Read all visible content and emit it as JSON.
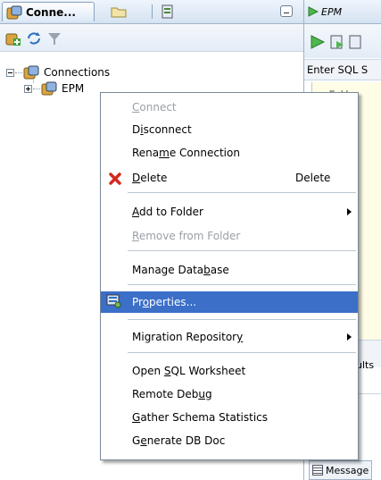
{
  "left": {
    "tabs": [
      {
        "label": "Conne..."
      }
    ],
    "tree": {
      "root": "Connections",
      "child": "EPM"
    }
  },
  "right": {
    "tab_label": "EPM",
    "sql_label": "Enter SQL S",
    "editor_text": "r w",
    "results_tab": "ults",
    "messages_tab": "Message"
  },
  "menu": {
    "items": [
      {
        "label": "Connect",
        "mnemonic_index": 0,
        "enabled": false
      },
      {
        "label": "Disconnect",
        "mnemonic_index": 1,
        "enabled": true
      },
      {
        "label": "Rename Connection",
        "mnemonic_index": 4,
        "enabled": true
      },
      {
        "label": "Delete",
        "mnemonic_index": 0,
        "enabled": true,
        "shortcut": "Delete",
        "icon": "red-x-icon"
      },
      {
        "label": "Add to Folder",
        "mnemonic_index": 0,
        "enabled": true,
        "submenu": true
      },
      {
        "label": "Remove from Folder",
        "mnemonic_index": 0,
        "enabled": false
      },
      {
        "label": "Manage Database",
        "mnemonic_index": 11,
        "enabled": true
      },
      {
        "label": "Properties...",
        "mnemonic_index": 2,
        "enabled": true,
        "highlighted": true,
        "icon": "properties-icon"
      },
      {
        "label": "Migration Repository",
        "mnemonic_index": 19,
        "enabled": true,
        "submenu": true
      },
      {
        "label": "Open SQL Worksheet",
        "mnemonic_index": 5,
        "enabled": true
      },
      {
        "label": "Remote Debug",
        "mnemonic_index": 10,
        "enabled": true
      },
      {
        "label": "Gather Schema Statistics",
        "mnemonic_index": 0,
        "enabled": true
      },
      {
        "label": "Generate DB Doc",
        "mnemonic_index": 1,
        "enabled": true
      }
    ]
  },
  "colors": {
    "highlight": "#3b6fc8",
    "disabled_text": "#9aa0a6",
    "editor_bg": "#fffde6"
  }
}
